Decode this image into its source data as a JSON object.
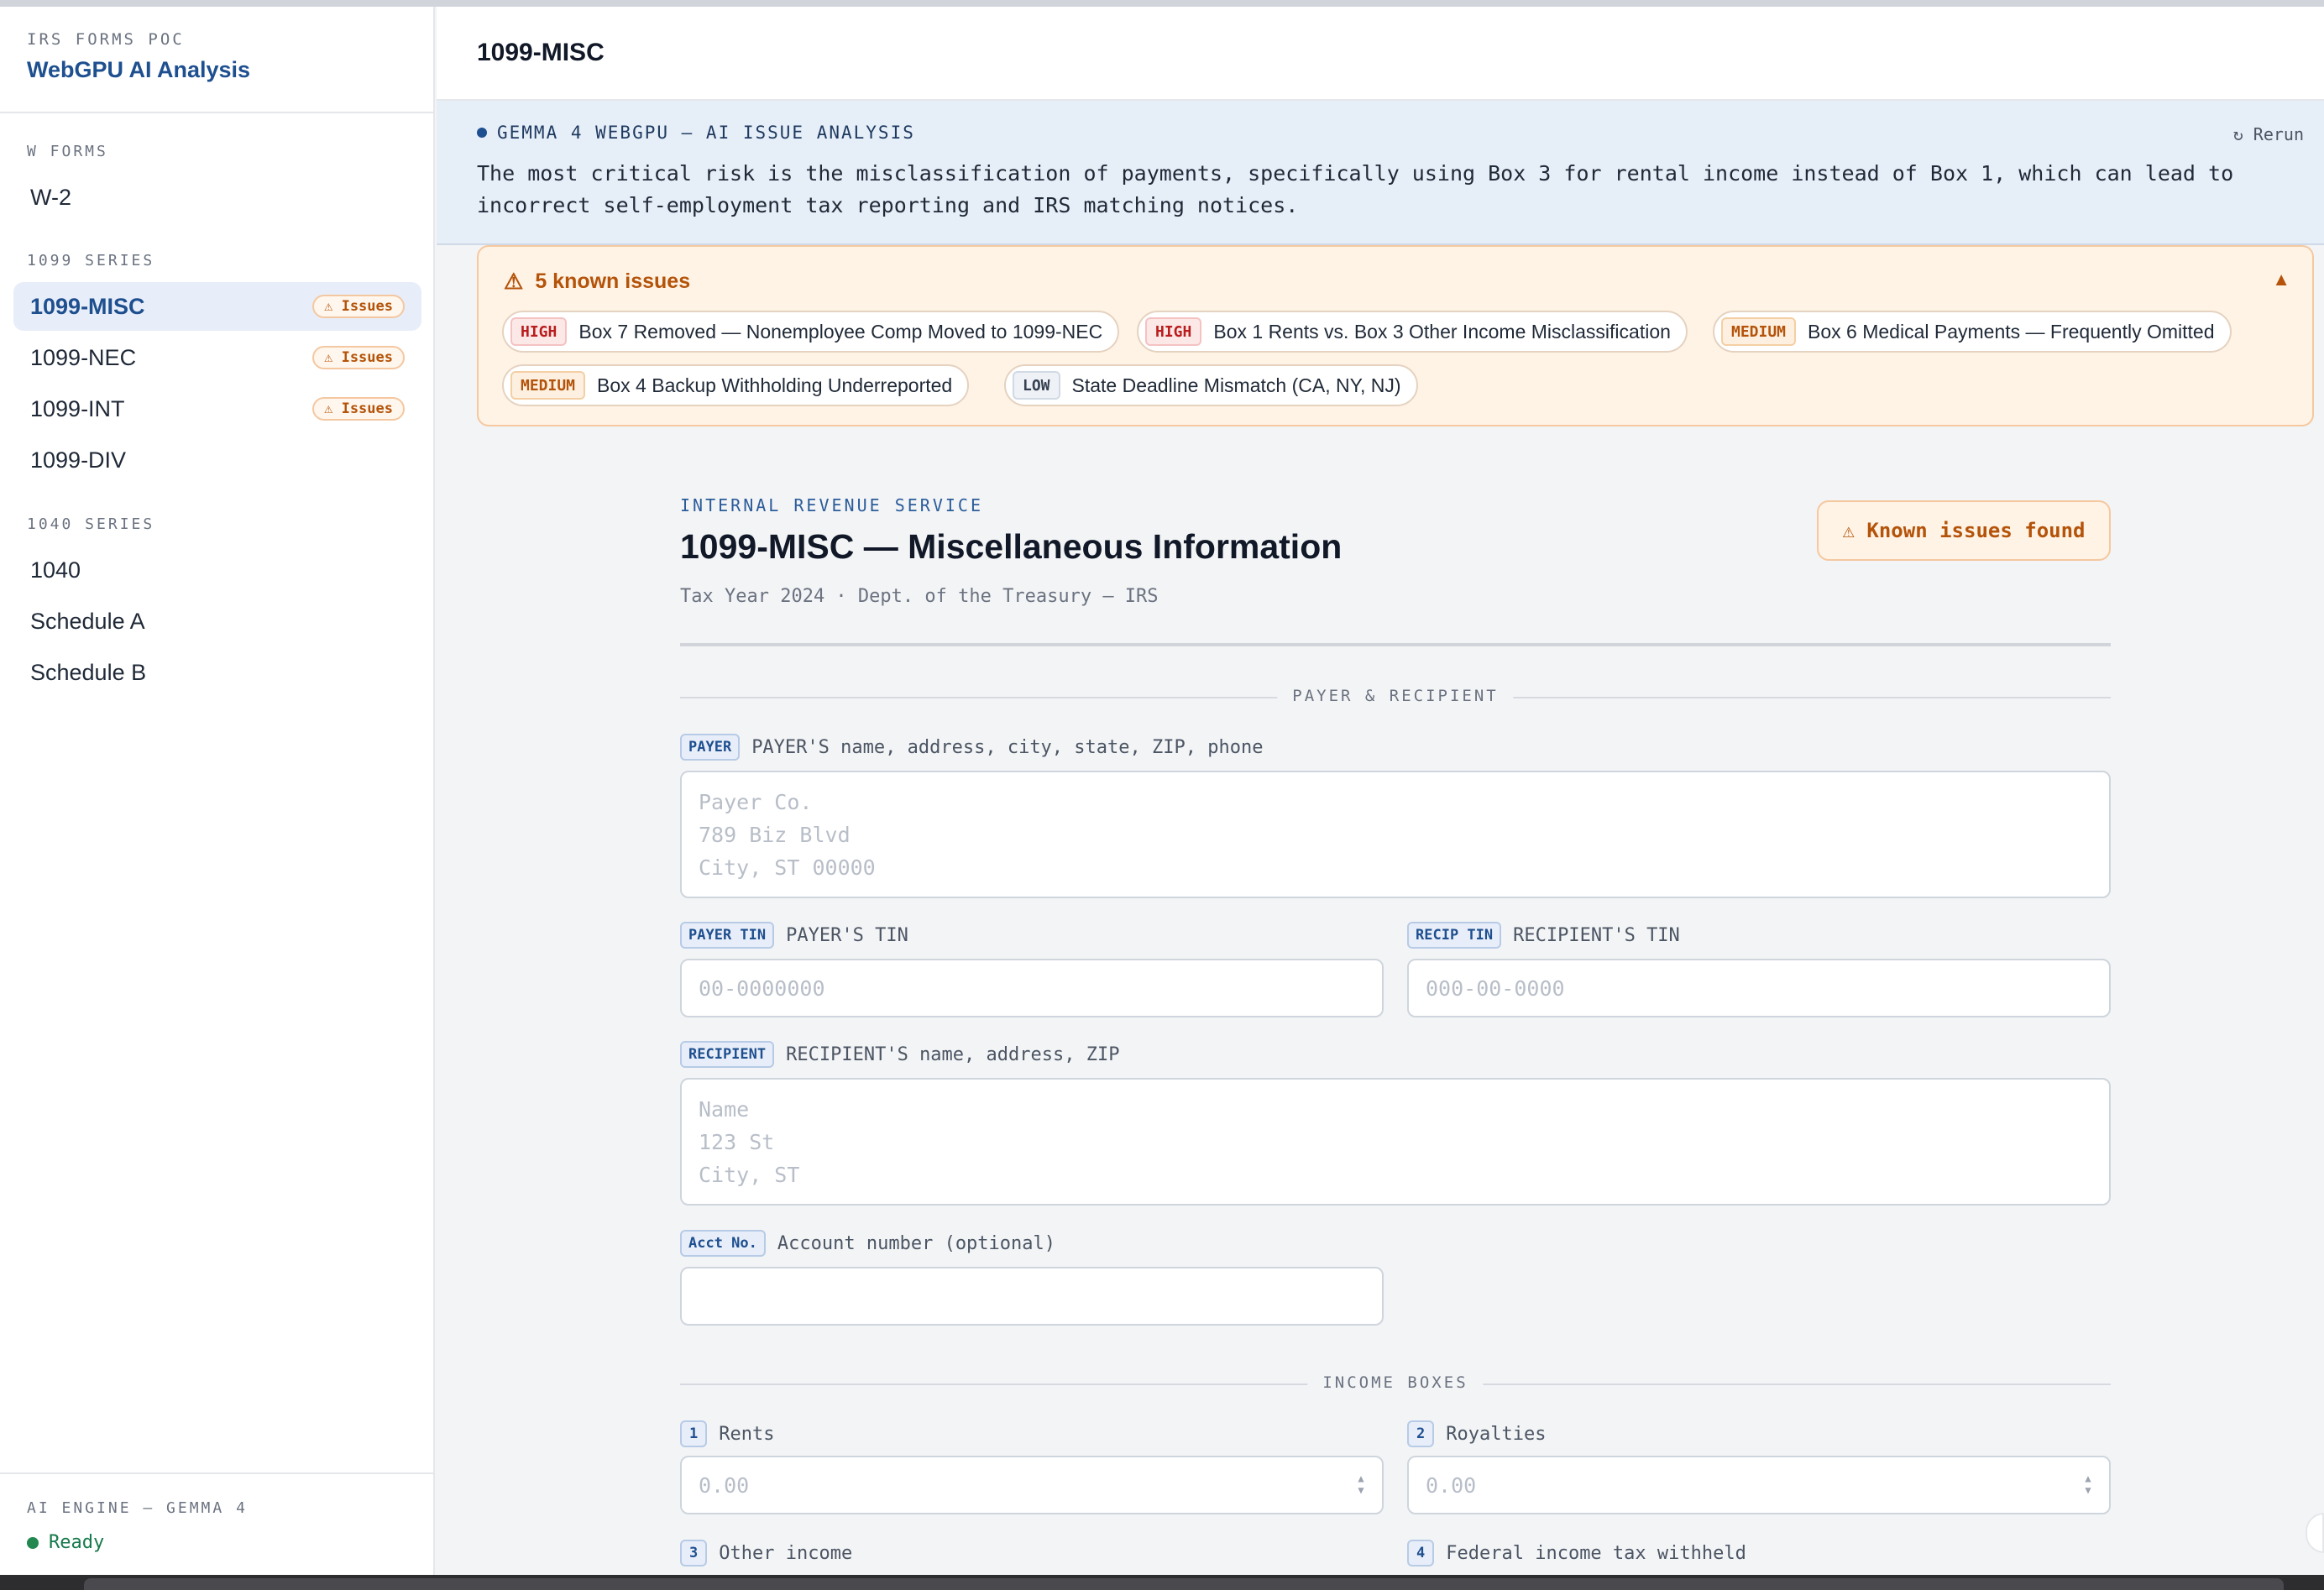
{
  "sidebar": {
    "brand_top": "IRS FORMS POC",
    "brand_title": "WebGPU AI Analysis",
    "sections": [
      {
        "label": "W FORMS",
        "items": [
          {
            "label": "W-2"
          }
        ]
      },
      {
        "label": "1099 SERIES",
        "items": [
          {
            "label": "1099-MISC",
            "badge": "⚠ Issues",
            "active": true
          },
          {
            "label": "1099-NEC",
            "badge": "⚠ Issues"
          },
          {
            "label": "1099-INT",
            "badge": "⚠ Issues"
          },
          {
            "label": "1099-DIV"
          }
        ]
      },
      {
        "label": "1040 SERIES",
        "items": [
          {
            "label": "1040"
          },
          {
            "label": "Schedule A"
          },
          {
            "label": "Schedule B"
          }
        ]
      }
    ],
    "engine_label": "AI ENGINE — GEMMA 4",
    "engine_status": "Ready",
    "engine_status_color": "#22884f"
  },
  "main": {
    "title": "1099-MISC",
    "ai_banner": {
      "heading": "GEMMA 4 WEBGPU — AI ISSUE ANALYSIS",
      "rerun_label": "↻ Rerun",
      "text": "The most critical risk is the misclassification of payments, specifically using Box 3 for rental income instead of Box 1, which can lead to incorrect self-employment tax reporting and IRS matching notices."
    },
    "issues": {
      "heading": "5 known issues",
      "collapse_icon": "▲",
      "items": [
        {
          "severity": "HIGH",
          "text": "Box 7 Removed — Nonemployee Comp Moved to 1099-NEC"
        },
        {
          "severity": "HIGH",
          "text": "Box 1 Rents vs. Box 3 Other Income Misclassification"
        },
        {
          "severity": "MEDIUM",
          "text": "Box 6 Medical Payments — Frequently Omitted"
        },
        {
          "severity": "MEDIUM",
          "text": "Box 4 Backup Withholding Underreported"
        },
        {
          "severity": "LOW",
          "text": "State Deadline Mismatch (CA, NY, NJ)"
        }
      ]
    }
  },
  "form": {
    "agency": "INTERNAL REVENUE SERVICE",
    "title": "1099-MISC — Miscellaneous Information",
    "subtitle": "Tax Year 2024 · Dept. of the Treasury — IRS",
    "known_issues_button": "⚠ Known issues found",
    "section_payer": "PAYER & RECIPIENT",
    "payer": {
      "tag": "PAYER",
      "label": "PAYER'S name, address, city, state, ZIP, phone",
      "placeholder": "Payer Co.\n789 Biz Blvd\nCity, ST 00000"
    },
    "payer_tin": {
      "tag": "PAYER TIN",
      "label": "PAYER'S TIN",
      "placeholder": "00-0000000"
    },
    "recip_tin": {
      "tag": "RECIP TIN",
      "label": "RECIPIENT'S TIN",
      "placeholder": "000-00-0000"
    },
    "recipient": {
      "tag": "RECIPIENT",
      "label": "RECIPIENT'S name, address, ZIP",
      "placeholder": "Name\n123 St\nCity, ST"
    },
    "account": {
      "tag": "Acct No.",
      "label": "Account number (optional)",
      "placeholder": ""
    },
    "section_income": "INCOME BOXES",
    "boxes": [
      {
        "num": "1",
        "label": "Rents",
        "placeholder": "0.00"
      },
      {
        "num": "2",
        "label": "Royalties",
        "placeholder": "0.00"
      },
      {
        "num": "3",
        "label": "Other income"
      },
      {
        "num": "4",
        "label": "Federal income tax withheld"
      }
    ]
  }
}
